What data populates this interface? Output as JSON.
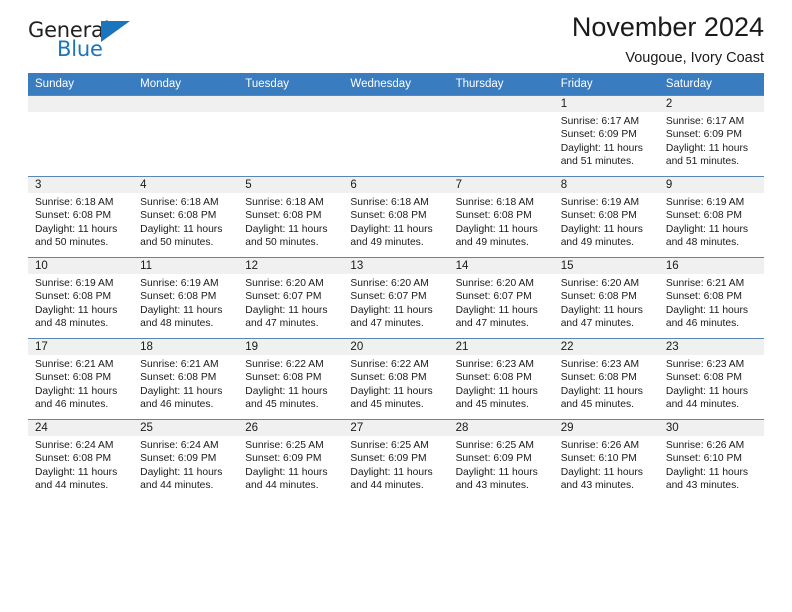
{
  "logo": {
    "word_general": "General",
    "word_blue": "Blue",
    "flag_icon": "triangle-flag-icon"
  },
  "header": {
    "month_title": "November 2024",
    "location": "Vougoue, Ivory Coast"
  },
  "colors": {
    "header_blue": "#3a7cc0",
    "brand_blue": "#1b75bc",
    "date_band_gray": "#f0f0f0",
    "row_divider": "#5a86b5"
  },
  "weekdays": [
    "Sunday",
    "Monday",
    "Tuesday",
    "Wednesday",
    "Thursday",
    "Friday",
    "Saturday"
  ],
  "labels": {
    "sunrise_prefix": "Sunrise: ",
    "sunset_prefix": "Sunset: ",
    "daylight_prefix": "Daylight: "
  },
  "weeks": [
    [
      {
        "date": "",
        "empty": true
      },
      {
        "date": "",
        "empty": true
      },
      {
        "date": "",
        "empty": true
      },
      {
        "date": "",
        "empty": true
      },
      {
        "date": "",
        "empty": true
      },
      {
        "date": "1",
        "sunrise": "Sunrise: 6:17 AM",
        "sunset": "Sunset: 6:09 PM",
        "daylight": "Daylight: 11 hours and 51 minutes."
      },
      {
        "date": "2",
        "sunrise": "Sunrise: 6:17 AM",
        "sunset": "Sunset: 6:09 PM",
        "daylight": "Daylight: 11 hours and 51 minutes."
      }
    ],
    [
      {
        "date": "3",
        "sunrise": "Sunrise: 6:18 AM",
        "sunset": "Sunset: 6:08 PM",
        "daylight": "Daylight: 11 hours and 50 minutes."
      },
      {
        "date": "4",
        "sunrise": "Sunrise: 6:18 AM",
        "sunset": "Sunset: 6:08 PM",
        "daylight": "Daylight: 11 hours and 50 minutes."
      },
      {
        "date": "5",
        "sunrise": "Sunrise: 6:18 AM",
        "sunset": "Sunset: 6:08 PM",
        "daylight": "Daylight: 11 hours and 50 minutes."
      },
      {
        "date": "6",
        "sunrise": "Sunrise: 6:18 AM",
        "sunset": "Sunset: 6:08 PM",
        "daylight": "Daylight: 11 hours and 49 minutes."
      },
      {
        "date": "7",
        "sunrise": "Sunrise: 6:18 AM",
        "sunset": "Sunset: 6:08 PM",
        "daylight": "Daylight: 11 hours and 49 minutes."
      },
      {
        "date": "8",
        "sunrise": "Sunrise: 6:19 AM",
        "sunset": "Sunset: 6:08 PM",
        "daylight": "Daylight: 11 hours and 49 minutes."
      },
      {
        "date": "9",
        "sunrise": "Sunrise: 6:19 AM",
        "sunset": "Sunset: 6:08 PM",
        "daylight": "Daylight: 11 hours and 48 minutes."
      }
    ],
    [
      {
        "date": "10",
        "sunrise": "Sunrise: 6:19 AM",
        "sunset": "Sunset: 6:08 PM",
        "daylight": "Daylight: 11 hours and 48 minutes."
      },
      {
        "date": "11",
        "sunrise": "Sunrise: 6:19 AM",
        "sunset": "Sunset: 6:08 PM",
        "daylight": "Daylight: 11 hours and 48 minutes."
      },
      {
        "date": "12",
        "sunrise": "Sunrise: 6:20 AM",
        "sunset": "Sunset: 6:07 PM",
        "daylight": "Daylight: 11 hours and 47 minutes."
      },
      {
        "date": "13",
        "sunrise": "Sunrise: 6:20 AM",
        "sunset": "Sunset: 6:07 PM",
        "daylight": "Daylight: 11 hours and 47 minutes."
      },
      {
        "date": "14",
        "sunrise": "Sunrise: 6:20 AM",
        "sunset": "Sunset: 6:07 PM",
        "daylight": "Daylight: 11 hours and 47 minutes."
      },
      {
        "date": "15",
        "sunrise": "Sunrise: 6:20 AM",
        "sunset": "Sunset: 6:08 PM",
        "daylight": "Daylight: 11 hours and 47 minutes."
      },
      {
        "date": "16",
        "sunrise": "Sunrise: 6:21 AM",
        "sunset": "Sunset: 6:08 PM",
        "daylight": "Daylight: 11 hours and 46 minutes."
      }
    ],
    [
      {
        "date": "17",
        "sunrise": "Sunrise: 6:21 AM",
        "sunset": "Sunset: 6:08 PM",
        "daylight": "Daylight: 11 hours and 46 minutes."
      },
      {
        "date": "18",
        "sunrise": "Sunrise: 6:21 AM",
        "sunset": "Sunset: 6:08 PM",
        "daylight": "Daylight: 11 hours and 46 minutes."
      },
      {
        "date": "19",
        "sunrise": "Sunrise: 6:22 AM",
        "sunset": "Sunset: 6:08 PM",
        "daylight": "Daylight: 11 hours and 45 minutes."
      },
      {
        "date": "20",
        "sunrise": "Sunrise: 6:22 AM",
        "sunset": "Sunset: 6:08 PM",
        "daylight": "Daylight: 11 hours and 45 minutes."
      },
      {
        "date": "21",
        "sunrise": "Sunrise: 6:23 AM",
        "sunset": "Sunset: 6:08 PM",
        "daylight": "Daylight: 11 hours and 45 minutes."
      },
      {
        "date": "22",
        "sunrise": "Sunrise: 6:23 AM",
        "sunset": "Sunset: 6:08 PM",
        "daylight": "Daylight: 11 hours and 45 minutes."
      },
      {
        "date": "23",
        "sunrise": "Sunrise: 6:23 AM",
        "sunset": "Sunset: 6:08 PM",
        "daylight": "Daylight: 11 hours and 44 minutes."
      }
    ],
    [
      {
        "date": "24",
        "sunrise": "Sunrise: 6:24 AM",
        "sunset": "Sunset: 6:08 PM",
        "daylight": "Daylight: 11 hours and 44 minutes."
      },
      {
        "date": "25",
        "sunrise": "Sunrise: 6:24 AM",
        "sunset": "Sunset: 6:09 PM",
        "daylight": "Daylight: 11 hours and 44 minutes."
      },
      {
        "date": "26",
        "sunrise": "Sunrise: 6:25 AM",
        "sunset": "Sunset: 6:09 PM",
        "daylight": "Daylight: 11 hours and 44 minutes."
      },
      {
        "date": "27",
        "sunrise": "Sunrise: 6:25 AM",
        "sunset": "Sunset: 6:09 PM",
        "daylight": "Daylight: 11 hours and 44 minutes."
      },
      {
        "date": "28",
        "sunrise": "Sunrise: 6:25 AM",
        "sunset": "Sunset: 6:09 PM",
        "daylight": "Daylight: 11 hours and 43 minutes."
      },
      {
        "date": "29",
        "sunrise": "Sunrise: 6:26 AM",
        "sunset": "Sunset: 6:10 PM",
        "daylight": "Daylight: 11 hours and 43 minutes."
      },
      {
        "date": "30",
        "sunrise": "Sunrise: 6:26 AM",
        "sunset": "Sunset: 6:10 PM",
        "daylight": "Daylight: 11 hours and 43 minutes."
      }
    ]
  ]
}
